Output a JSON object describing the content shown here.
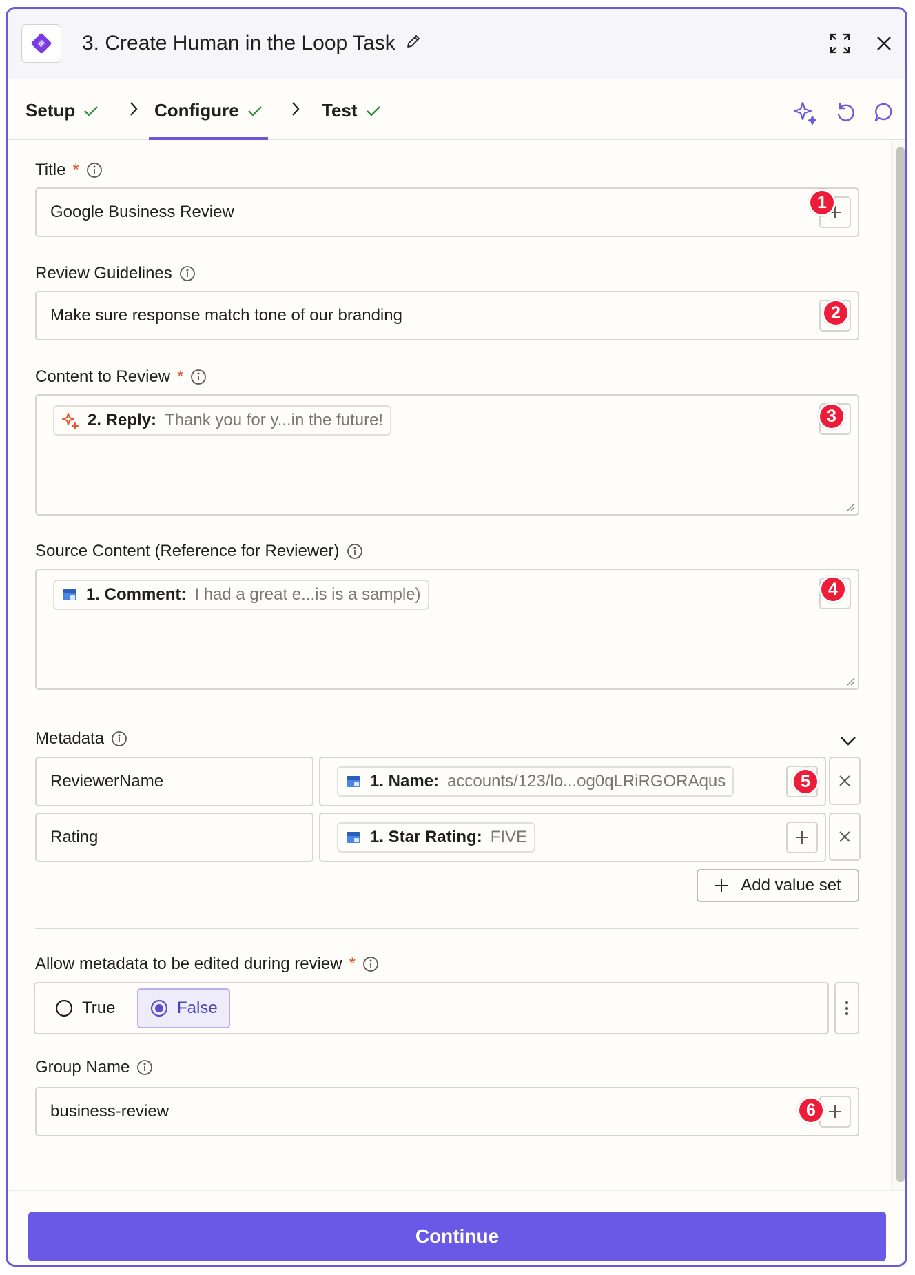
{
  "header": {
    "title": "3. Create Human in the Loop Task",
    "icons": [
      "app-logo",
      "pencil-icon",
      "expand-icon",
      "close-icon"
    ]
  },
  "tabs": [
    {
      "label": "Setup",
      "complete": true
    },
    {
      "label": "Configure",
      "complete": true,
      "active": true
    },
    {
      "label": "Test",
      "complete": true
    }
  ],
  "tools": [
    "sparkle-icon",
    "undo-icon",
    "comment-icon"
  ],
  "colors": {
    "accent": "#6a5ad8",
    "required": "#e4572e",
    "badge": "#ed1d3a",
    "check": "#2f8f4a"
  },
  "fields": {
    "title": {
      "label": "Title",
      "required": true,
      "value": "Google Business Review",
      "badge": "1"
    },
    "guidelines": {
      "label": "Review Guidelines",
      "value": "Make sure response match tone of our branding",
      "badge": "2"
    },
    "content": {
      "label": "Content to Review",
      "required": true,
      "chip_key": "2. Reply:",
      "chip_value": "Thank you for y...in the future!",
      "badge": "3"
    },
    "source": {
      "label": "Source Content (Reference for Reviewer)",
      "chip_key": "1. Comment:",
      "chip_value": "I had a great e...is is a sample)",
      "badge": "4"
    },
    "metadata": {
      "label": "Metadata",
      "rows": [
        {
          "key": "ReviewerName",
          "chip_key": "1. Name:",
          "chip_value": "accounts/123/lo...og0qLRiRGORAqus",
          "badge": "5"
        },
        {
          "key": "Rating",
          "chip_key": "1. Star Rating:",
          "chip_value": "FIVE"
        }
      ],
      "add_label": "Add value set"
    },
    "allow_edit": {
      "label": "Allow metadata to be edited during review",
      "required": true,
      "options": [
        "True",
        "False"
      ],
      "selected": "False"
    },
    "group": {
      "label": "Group Name",
      "value": "business-review",
      "badge": "6"
    }
  },
  "footer": {
    "continue_label": "Continue"
  }
}
